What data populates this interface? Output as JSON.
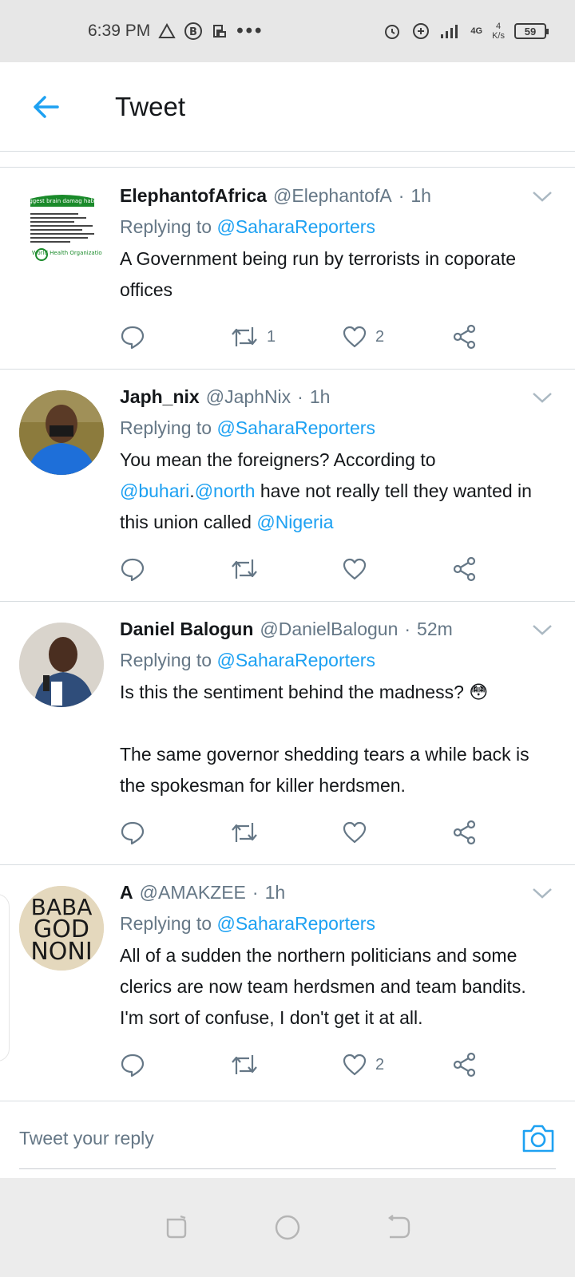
{
  "status_bar": {
    "time": "6:39 PM",
    "net_type": "4G",
    "net_speed_value": "4",
    "net_speed_unit": "K/s",
    "battery": "59"
  },
  "header": {
    "title": "Tweet"
  },
  "tweets": [
    {
      "author": "ElephantofAfrica",
      "handle": "@ElephantofA",
      "time": "1h",
      "replying_prefix": "Replying to",
      "replying_to": "@SaharaReporters",
      "text": "A Government being run by terrorists in coporate offices",
      "retweets": "1",
      "likes": "2",
      "avatar_image_text": [
        "Biggest brain damag habits",
        "World Health Organization"
      ]
    },
    {
      "author": "Japh_nix",
      "handle": "@JaphNix",
      "time": "1h",
      "replying_prefix": "Replying to",
      "replying_to": "@SaharaReporters",
      "text_parts": {
        "t1": "You mean the foreigners? According to ",
        "m1": "@buhari",
        "t2": ".",
        "m2": "@north",
        "t3": " have not really tell they wanted in this union called ",
        "m3": "@Nigeria"
      },
      "retweets": "",
      "likes": ""
    },
    {
      "author": "Daniel Balogun",
      "handle": "@DanielBalogun",
      "time": "52m",
      "replying_prefix": "Replying to",
      "replying_to": "@SaharaReporters",
      "text_line1": "Is this the sentiment behind the madness? 😳",
      "text_line2": "The same governor shedding tears a while back is the spokesman for killer herdsmen.",
      "retweets": "",
      "likes": ""
    },
    {
      "author": "A",
      "handle": "@AMAKZEE",
      "time": "1h",
      "replying_prefix": "Replying to",
      "replying_to": "@SaharaReporters",
      "text": "All of a sudden the northern politicians and some clerics are now team herdsmen and team bandits.  I'm sort of confuse, I don't get it at all.",
      "retweets": "",
      "likes": "2",
      "avatar_image_text": [
        "BABA",
        "GOD",
        "NONI"
      ]
    }
  ],
  "reply_bar": {
    "placeholder": "Tweet your reply"
  },
  "colors": {
    "accent": "#1da1f2",
    "muted": "#657786",
    "text": "#14171a",
    "divider": "#d8dde1"
  }
}
